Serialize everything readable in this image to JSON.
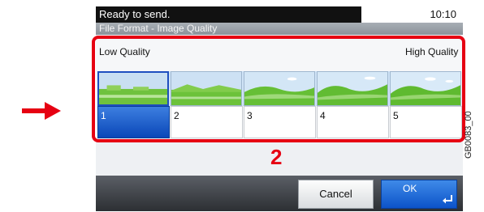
{
  "status_bar": {
    "message": "Ready to send.",
    "time": "10:10"
  },
  "screen_title": "File Format - Image Quality",
  "quality": {
    "low_label": "Low Quality",
    "high_label": "High Quality",
    "selected_level": 1,
    "thumbnail_icons": [
      "landscape-thumbnail-icon",
      "landscape-thumbnail-icon",
      "landscape-thumbnail-icon",
      "landscape-thumbnail-icon",
      "landscape-thumbnail-icon"
    ],
    "levels": [
      "1",
      "2",
      "3",
      "4",
      "5"
    ]
  },
  "callout_number": "2",
  "footer": {
    "cancel_label": "Cancel",
    "ok_label": "OK",
    "ok_icon": "enter-icon"
  },
  "figure_code": "GB0083_00",
  "colors": {
    "highlight": "#e60012",
    "selected": "#0a47b8"
  }
}
